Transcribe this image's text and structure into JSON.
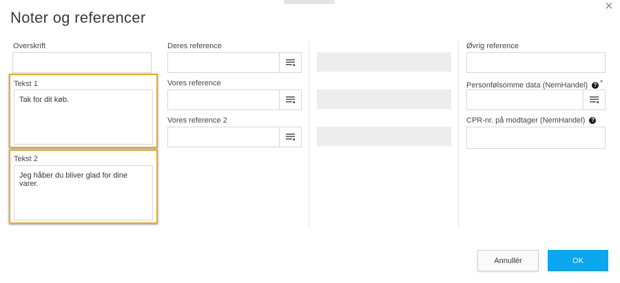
{
  "dialog": {
    "title": "Noter og referencer",
    "close_icon": "×"
  },
  "col1": {
    "overskrift_label": "Overskrift",
    "overskrift_value": "",
    "tekst1_label": "Tekst 1",
    "tekst1_value": "Tak for dit køb.",
    "tekst2_label": "Tekst 2",
    "tekst2_value": "Jeg håber du bliver glad for dine varer."
  },
  "col2": {
    "deres_reference_label": "Deres reference",
    "vores_reference_label": "Vores reference",
    "vores_reference2_label": "Vores reference 2"
  },
  "col4": {
    "oevrig_reference_label": "Øvrig reference",
    "personfoelsomme_label": "Personfølsomme data (NemHandel)",
    "personfoelsomme_help": "?",
    "personfoelsomme_required": "*",
    "cpr_label": "CPR-nr. på modtager (NemHandel)",
    "cpr_help": "?"
  },
  "buttons": {
    "cancel": "Annullér",
    "ok": "OK"
  },
  "colors": {
    "highlight": "#f0a81c",
    "ok_button": "#0aa6f0",
    "readonly_field": "#ededed"
  },
  "icons": {
    "lookup": "list-lookup-icon",
    "help": "help-circle-icon",
    "close": "close-icon"
  }
}
